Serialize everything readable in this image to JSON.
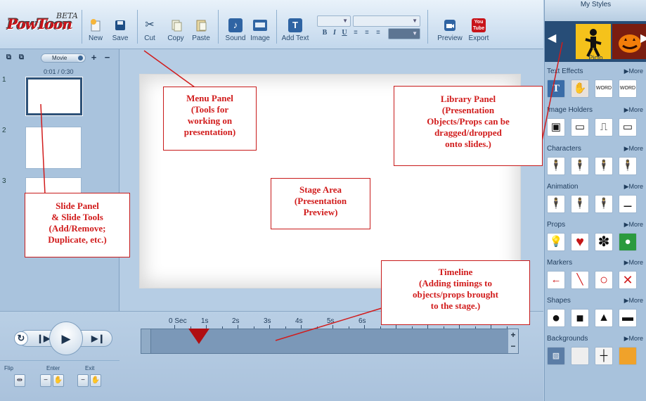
{
  "toolbar": {
    "logo_text": "PowToon",
    "beta_label": "BETA",
    "new_label": "New",
    "save_label": "Save",
    "cut_label": "Cut",
    "copy_label": "Copy",
    "paste_label": "Paste",
    "sound_label": "Sound",
    "image_label": "Image",
    "add_text_label": "Add Text",
    "bold_label": "B",
    "italic_label": "I",
    "underline_label": "U",
    "preview_label": "Preview",
    "export_label": "Export",
    "youtube_top": "You",
    "youtube_bottom": "Tube"
  },
  "slide_panel": {
    "movie_label": "Movie",
    "time_display": "0:01 / 0:30",
    "slides": [
      "1",
      "2",
      "3"
    ]
  },
  "timeline": {
    "ticks": [
      "0 Sec",
      "1s",
      "2s",
      "3s",
      "4s",
      "5s",
      "6s"
    ]
  },
  "bottom_tools": {
    "flip_label": "Flip",
    "enter_label": "Enter",
    "exit_label": "Exit"
  },
  "library": {
    "title": "My Styles",
    "selected_style": "Picto",
    "more_label": "▶More",
    "categories": [
      {
        "name": "Text Effects"
      },
      {
        "name": "Image Holders"
      },
      {
        "name": "Characters"
      },
      {
        "name": "Animation"
      },
      {
        "name": "Props"
      },
      {
        "name": "Markers"
      },
      {
        "name": "Shapes"
      },
      {
        "name": "Backgrounds"
      }
    ]
  },
  "annotations": {
    "menu_panel": [
      "Menu Panel",
      "(Tools for",
      "working on",
      "presentation)"
    ],
    "library_panel": [
      "Library Panel",
      "(Presentation",
      "Objects/Props can be",
      "dragged/dropped",
      "onto slides.)"
    ],
    "stage_area": [
      "Stage Area",
      "(Presentation",
      "Preview)"
    ],
    "slide_panel": [
      "Slide Panel",
      "& Slide Tools",
      "(Add/Remove;",
      "Duplicate, etc.)"
    ],
    "timeline": [
      "Timeline",
      "(Adding timings to",
      "objects/props brought",
      "to the stage.)"
    ]
  }
}
